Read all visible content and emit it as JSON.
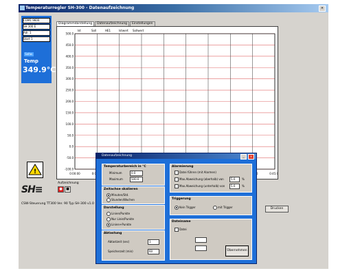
{
  "window": {
    "title": "Temperaturregler SH-300 - Datenaufzeichnung"
  },
  "left_panel": {
    "rows": [
      "COM1 9600",
      "SH 300 E",
      "Adr. 1",
      "Start 1"
    ],
    "tag": "Sollw.",
    "temp_label": "Temp",
    "temp_value": "349.9°C"
  },
  "tabs": [
    "Diagrammdarstellung",
    "Datenaufzeichnung",
    "Einstellungen"
  ],
  "chart_data": {
    "type": "line",
    "title": "",
    "legend": [
      "Ist",
      "Soll",
      "HE1",
      "Istwert",
      "Sollwert"
    ],
    "xlabel": "",
    "ylabel": "",
    "y_ticks": [
      "500.0",
      "450.0",
      "400.0",
      "350.0",
      "300.0",
      "250.0",
      "200.0",
      "150.0",
      "100.0",
      "50.0",
      "0.0",
      "-50.0",
      "-100.0"
    ],
    "x_ticks": [
      "0:00:00",
      "0:05:00",
      "0:10:00",
      "0:15:00",
      "0:20:00",
      "0:25:00",
      "0:30:00",
      "0:35:00",
      "0:40:00",
      "0:45:00"
    ],
    "grid": true,
    "series": []
  },
  "recorder": {
    "label": "Aufzeichnung",
    "buttons": [
      "●",
      "■"
    ],
    "extra": "Pause"
  },
  "bottom": {
    "model_line": "CSW-Steuerung TT300 Ver. 90 Typ SH-300 v1.0",
    "print_button": "Drucken"
  },
  "dialog": {
    "title": "Datenaufzeichnung",
    "temp_group": {
      "title": "Temperaturbereich in °C",
      "min_label": "Minimum",
      "min_value": "0.0",
      "max_label": "Maximum",
      "max_value": "500.0"
    },
    "time_group": {
      "title": "Zeitachse skalieren",
      "opt1": "Minuten/Std.",
      "opt2": "Stunden/Wochen"
    },
    "display_group": {
      "title": "Darstellung",
      "opt1": "Linien/Punkte",
      "opt2": "Nur Linie/Punkte",
      "opt3": "Linien+Punkte"
    },
    "interval_group": {
      "title": "Abtastung",
      "label1": "Abtastzeit (sec)",
      "val1": "1",
      "label2": "Speicherzeit (min)",
      "val2": "60"
    },
    "alarm_group": {
      "title": "Alarmierung",
      "opt1": "Datei führen (mit Alarmen)",
      "opt2": "Max.Abweichung (oberhalb) von",
      "val2": "5.0",
      "unit2": "%",
      "opt3": "Max.Abweichung (unterhalb) von",
      "val3": "5.0",
      "unit3": "%"
    },
    "trigger_group": {
      "title": "Triggerung",
      "opt1": "Kein Trigger",
      "opt2": "mit Trigger"
    },
    "file_group": {
      "title": "Dateiname",
      "opt1": "Datei",
      "val1": "",
      "val2": ""
    },
    "ok_button": "Übernehmen"
  },
  "colors": {
    "accent": "#1e6fd8",
    "grid_h": "#e06a6a",
    "grid_v": "#555555"
  },
  "icons": [
    "warning-icon",
    "close-icon",
    "minimize-icon"
  ]
}
